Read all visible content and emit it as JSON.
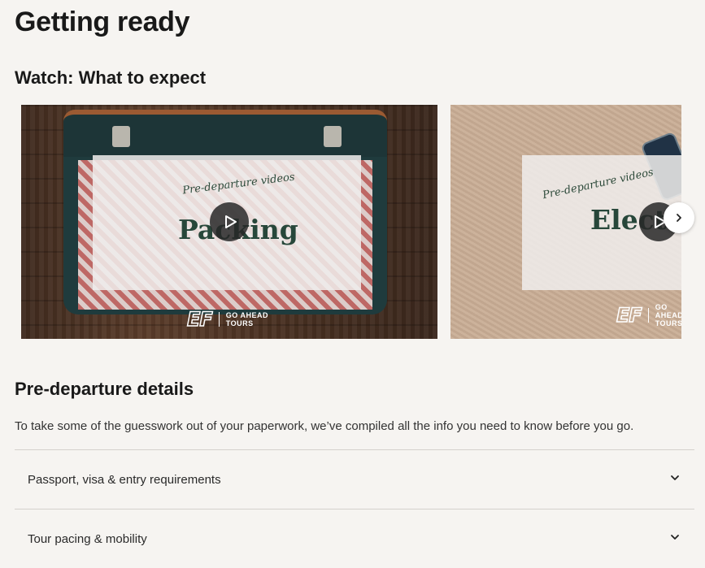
{
  "page": {
    "title": "Getting ready"
  },
  "videos": {
    "heading": "Watch: What to expect",
    "items": [
      {
        "caption": "Pre-departure videos",
        "word": "Packing",
        "brand_lines": [
          "GO AHEAD",
          "TOURS"
        ],
        "logo": "EF"
      },
      {
        "caption": "Pre-departure videos",
        "word": "Electr",
        "brand_lines": [
          "GO AHEAD",
          "TOURS"
        ],
        "logo": "EF"
      }
    ],
    "next_icon": "chevron-right-icon",
    "play_icon": "play-icon"
  },
  "details": {
    "heading": "Pre-departure details",
    "intro": "To take some of the guesswork out of your paperwork, we’ve compiled all the info you need to know before you go.",
    "accordion": [
      {
        "label": "Passport, visa & entry requirements",
        "icon": "chevron-down-icon"
      },
      {
        "label": "Tour pacing & mobility",
        "icon": "chevron-down-icon"
      }
    ]
  }
}
